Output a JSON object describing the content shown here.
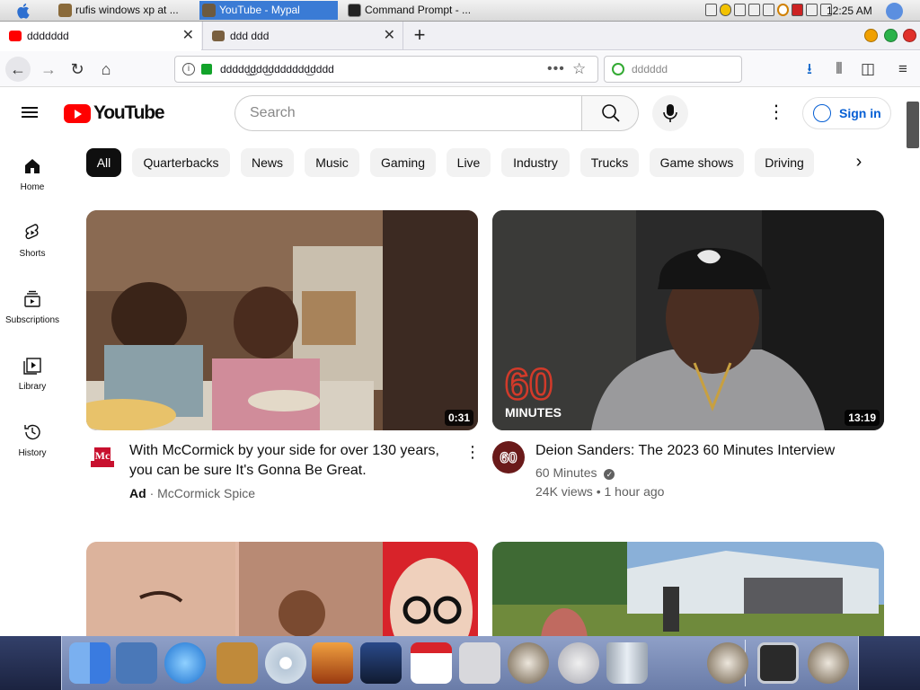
{
  "os_bar": {
    "tasks": [
      {
        "label": "rufis windows xp at ..."
      },
      {
        "label": "YouTube - Mypal"
      },
      {
        "label": "Command Prompt - ..."
      }
    ],
    "time": "12:25 AM"
  },
  "browser": {
    "tabs": [
      {
        "label": "ddddddd"
      },
      {
        "label": "ddd ddd"
      }
    ],
    "url": "ddddd͜͜ddd͜ddddddd͜dddd",
    "search_placeholder": "dddddd"
  },
  "youtube": {
    "logo_text": "YouTube",
    "search_placeholder": "Search",
    "sign_in": "Sign in",
    "chips": [
      "All",
      "Quarterbacks",
      "News",
      "Music",
      "Gaming",
      "Live",
      "Industry",
      "Trucks",
      "Game shows",
      "Driving"
    ],
    "rail": [
      {
        "label": "Home",
        "icon": "home-icon"
      },
      {
        "label": "Shorts",
        "icon": "shorts-icon"
      },
      {
        "label": "Subscriptions",
        "icon": "subscriptions-icon"
      },
      {
        "label": "Library",
        "icon": "library-icon"
      },
      {
        "label": "History",
        "icon": "history-icon"
      }
    ],
    "videos": [
      {
        "title": "With McCormick by your side for over 130 years, you can be sure It's Gonna Be Great.",
        "duration": "0:31",
        "ad_label": "Ad",
        "channel": "McCormick Spice"
      },
      {
        "title": "Deion Sanders: The 2023 60 Minutes Interview",
        "duration": "13:19",
        "thumb_logo": "60 MINUTES",
        "channel": "60 Minutes",
        "views": "24K views",
        "age": "1 hour ago"
      }
    ]
  },
  "colors": {
    "youtube_red": "#ff0000",
    "signin_blue": "#065fd4",
    "os_accent": "#3a7bd5"
  }
}
